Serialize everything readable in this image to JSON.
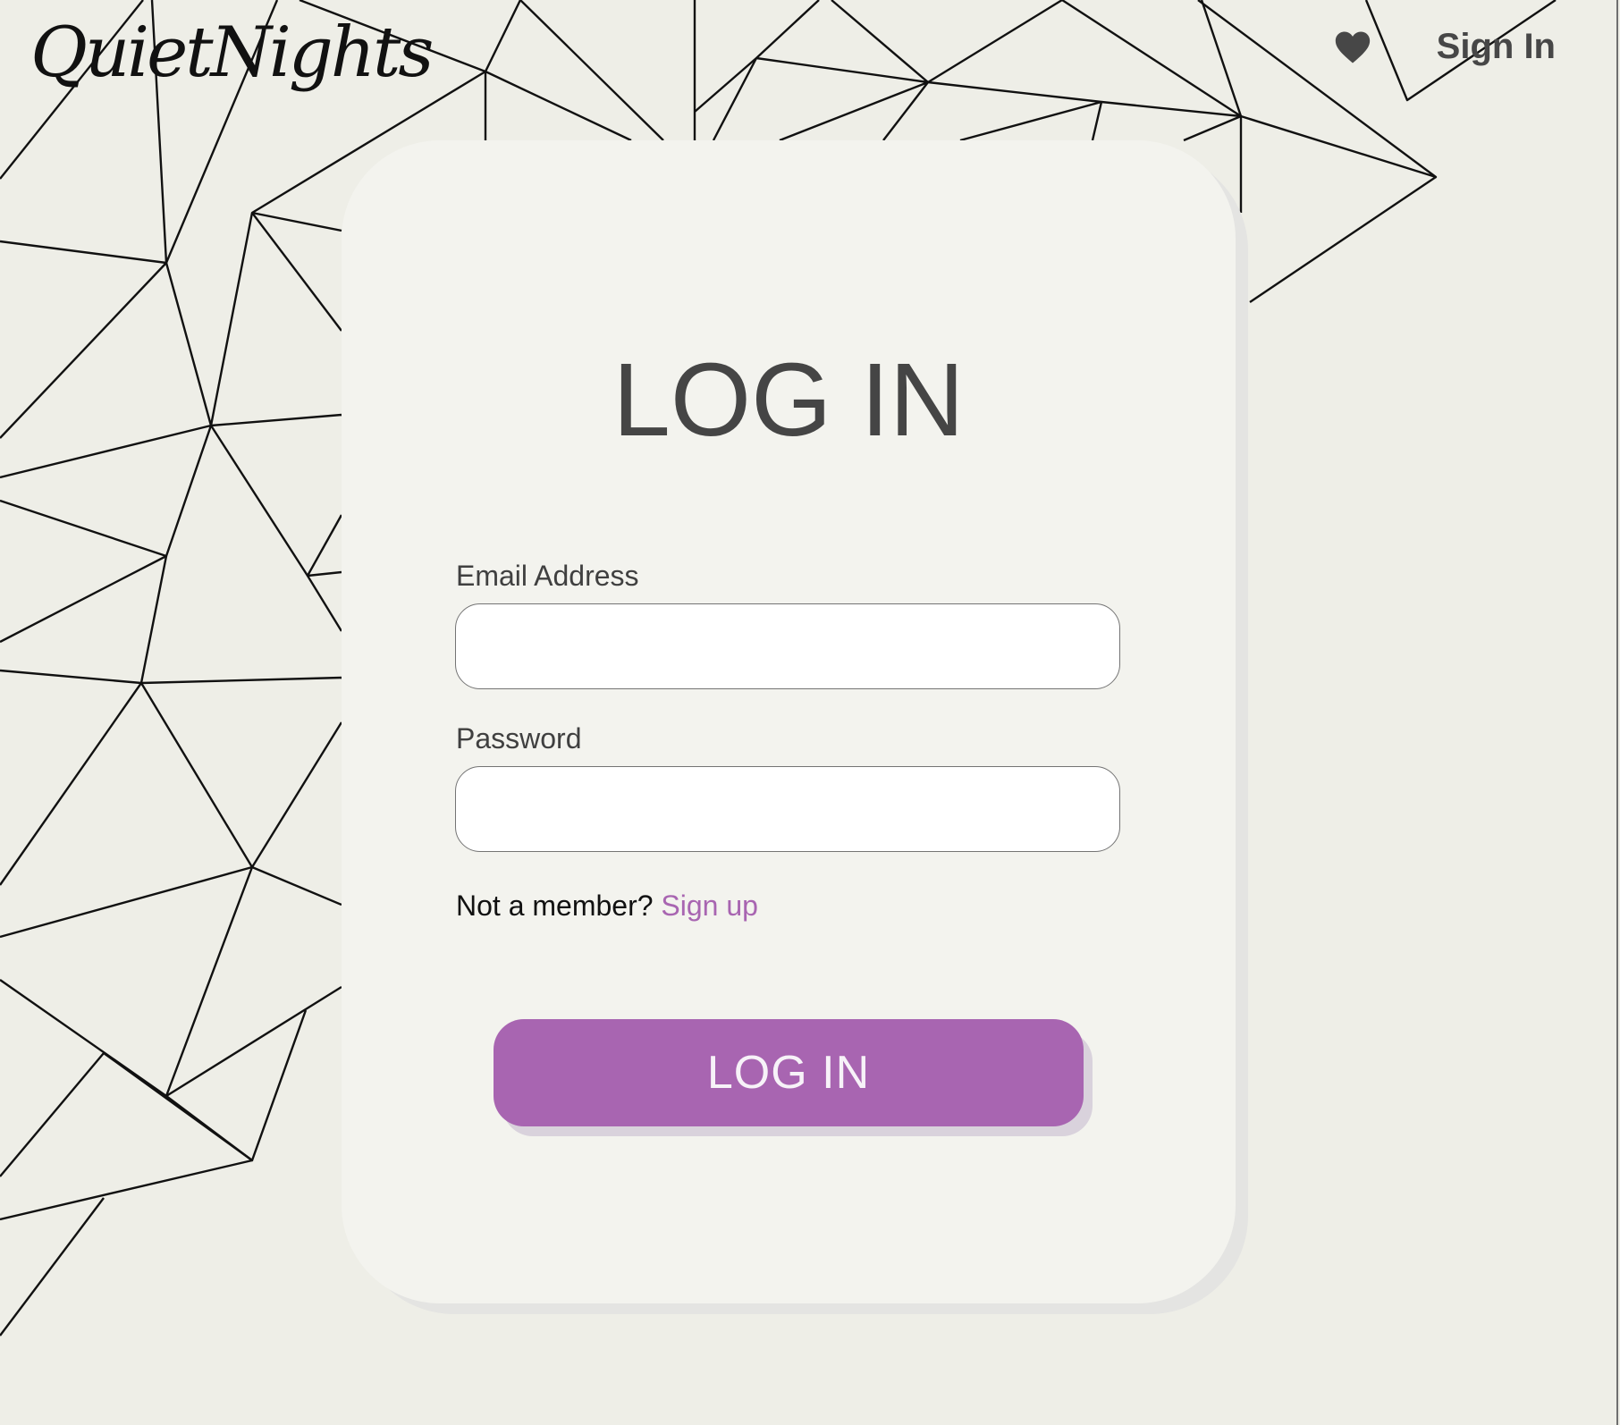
{
  "header": {
    "logo_text": "QuietNights",
    "favorites_icon": "heart-icon",
    "sign_in_label": "Sign In"
  },
  "login_form": {
    "title": "LOG IN",
    "email": {
      "label": "Email Address",
      "value": "",
      "placeholder": ""
    },
    "password": {
      "label": "Password",
      "value": "",
      "placeholder": ""
    },
    "member_prompt": "Not a member?",
    "signup_label": "Sign up",
    "submit_label": "LOG IN"
  },
  "colors": {
    "background": "#eeeee7",
    "card": "#f3f3ee",
    "accent": "#a865b1",
    "text_dark": "#454545",
    "line_pattern": "#111111"
  }
}
